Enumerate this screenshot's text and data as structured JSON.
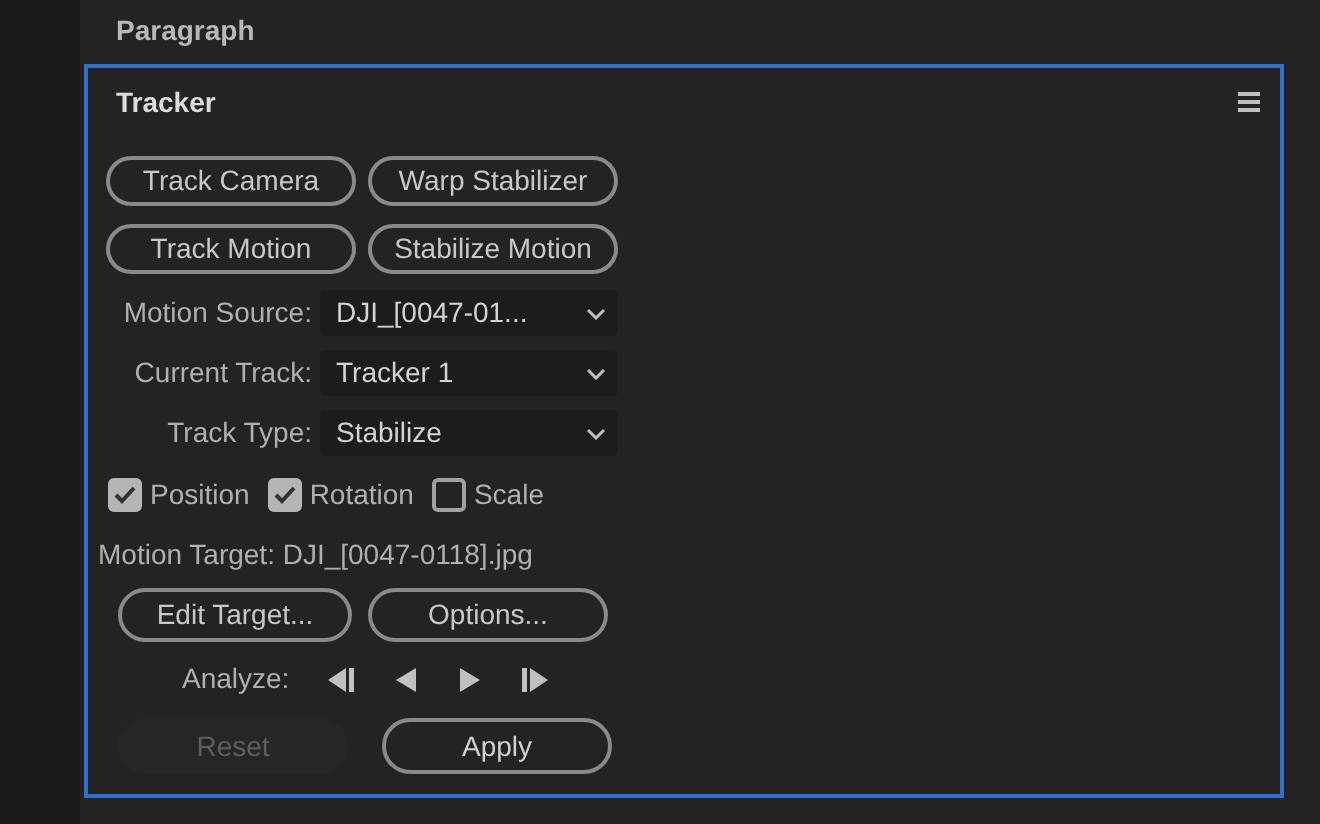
{
  "header": {
    "title": "Paragraph"
  },
  "panel": {
    "title": "Tracker",
    "selected": true,
    "track_buttons": [
      {
        "label": "Track Camera"
      },
      {
        "label": "Warp Stabilizer"
      },
      {
        "label": "Track Motion"
      },
      {
        "label": "Stabilize Motion"
      }
    ],
    "dropdowns": [
      {
        "label": "Motion Source:",
        "value": "DJI_[0047-01..."
      },
      {
        "label": "Current Track:",
        "value": "Tracker 1"
      },
      {
        "label": "Track Type:",
        "value": "Stabilize"
      }
    ],
    "checkboxes": [
      {
        "label": "Position",
        "checked": true
      },
      {
        "label": "Rotation",
        "checked": true
      },
      {
        "label": "Scale",
        "checked": false
      }
    ],
    "motion_target": "Motion Target: DJI_[0047-0118].jpg",
    "target_buttons": [
      {
        "label": "Edit Target..."
      },
      {
        "label": "Options..."
      }
    ],
    "analyze_label": "Analyze:",
    "analyze_controls": [
      {
        "kind": "back-all"
      },
      {
        "kind": "back"
      },
      {
        "kind": "forward"
      },
      {
        "kind": "forward-all"
      }
    ],
    "action_buttons": [
      {
        "label": "Reset",
        "disabled": true
      },
      {
        "label": "Apply",
        "disabled": false
      }
    ]
  }
}
